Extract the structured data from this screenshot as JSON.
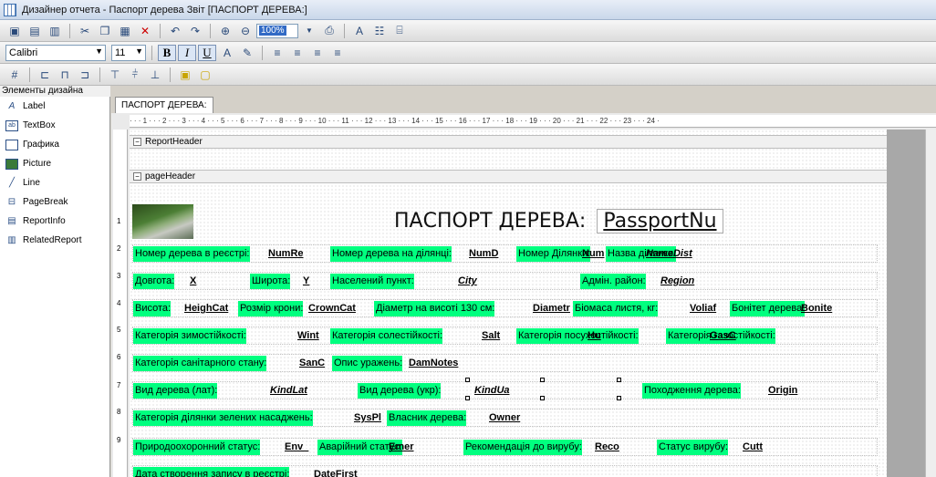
{
  "window": {
    "title": "Дизайнер отчета - Паспорт дерева Звіт [ПАСПОРТ ДЕРЕВА:]"
  },
  "toolbar": {
    "zoom": "100%",
    "font_name": "Calibri",
    "font_size": "11",
    "bold": "B",
    "italic": "I",
    "underline": "U"
  },
  "palette": {
    "title": "Элементы дизайна",
    "items": [
      {
        "label": "Label",
        "icon": "label-icon"
      },
      {
        "label": "TextBox",
        "icon": "textbox-icon"
      },
      {
        "label": "Графика",
        "icon": "graphic-icon"
      },
      {
        "label": "Picture",
        "icon": "picture-icon"
      },
      {
        "label": "Line",
        "icon": "line-icon"
      },
      {
        "label": "PageBreak",
        "icon": "pagebreak-icon"
      },
      {
        "label": "ReportInfo",
        "icon": "reportinfo-icon"
      },
      {
        "label": "RelatedReport",
        "icon": "relatedreport-icon"
      }
    ]
  },
  "tab": {
    "label": "ПАСПОРТ ДЕРЕВА:"
  },
  "ruler": {
    "top": "· · · 1 · · · 2 · · · 3 · · · 4 · · · 5 · · · 6 · · · 7 · · · 8 · · · 9 · · · 10 · · · 11 · · · 12 · · · 13 · · · 14 · · · 15 · · · 16 · · · 17 · · · 18 · · · 19 · · · 20 · · · 21 · · · 22 · · · 23 · · · 24 ·",
    "left": [
      "1",
      "2",
      "3",
      "4",
      "5",
      "6",
      "7",
      "8",
      "9"
    ]
  },
  "bands": {
    "report_header": "ReportHeader",
    "page_header": "pageHeader"
  },
  "report": {
    "title": "ПАСПОРТ ДЕРЕВА:",
    "title_field": "PassportNu",
    "rows": [
      [
        {
          "t": "lbl",
          "v": "Номер дерева в реєстрі:"
        },
        {
          "t": "fld",
          "v": "NumRe"
        },
        {
          "t": "lbl",
          "v": "Номер дерева на ділянці:"
        },
        {
          "t": "fld",
          "v": "NumD"
        },
        {
          "t": "lbl",
          "v": "Номер Ділянки:"
        },
        {
          "t": "fld",
          "v": "Num"
        },
        {
          "t": "lbl",
          "v": "Назва ділянки:"
        },
        {
          "t": "fld",
          "v": "NameDist",
          "it": true
        }
      ],
      [
        {
          "t": "lbl",
          "v": "Довгота:"
        },
        {
          "t": "fld",
          "v": "X"
        },
        {
          "t": "lbl",
          "v": "Широта:"
        },
        {
          "t": "fld",
          "v": "Y"
        },
        {
          "t": "lbl",
          "v": "Населений пункт:"
        },
        {
          "t": "fld",
          "v": "City",
          "it": true
        },
        {
          "t": "lbl",
          "v": "Адмін. район:"
        },
        {
          "t": "fld",
          "v": "Region",
          "it": true
        }
      ],
      [
        {
          "t": "lbl",
          "v": "Висота:"
        },
        {
          "t": "fld",
          "v": "HeighCat"
        },
        {
          "t": "lbl",
          "v": "Розмір крони:"
        },
        {
          "t": "fld",
          "v": "CrownCat"
        },
        {
          "t": "lbl",
          "v": "Діаметр на висоті 130 см:"
        },
        {
          "t": "fld",
          "v": "Diametr"
        },
        {
          "t": "lbl",
          "v": "Біомаса листя, кг:"
        },
        {
          "t": "fld",
          "v": "Voliaf"
        },
        {
          "t": "lbl",
          "v": "Бонітет дерева:"
        },
        {
          "t": "fld",
          "v": "Bonite"
        }
      ],
      [
        {
          "t": "lbl",
          "v": "Категорія зимостійкості:"
        },
        {
          "t": "fld",
          "v": "Wint"
        },
        {
          "t": "lbl",
          "v": "Категорія солестійкості:"
        },
        {
          "t": "fld",
          "v": "Salt"
        },
        {
          "t": "lbl",
          "v": "Категорія посухостійкості:"
        },
        {
          "t": "fld",
          "v": "Hu"
        },
        {
          "t": "lbl",
          "v": "Категорія газостійкості:"
        },
        {
          "t": "fld",
          "v": "GasC"
        }
      ],
      [
        {
          "t": "lbl",
          "v": "Категорія санітарного стану:"
        },
        {
          "t": "fld",
          "v": "SanC"
        },
        {
          "t": "lbl",
          "v": "Опис уражень:"
        },
        {
          "t": "fld",
          "v": "DamNotes"
        }
      ],
      [
        {
          "t": "lbl",
          "v": "Вид дерева (лат):"
        },
        {
          "t": "fld",
          "v": "KindLat",
          "it": true
        },
        {
          "t": "lbl",
          "v": "Вид дерева (укр):"
        },
        {
          "t": "fld",
          "v": "KindUa",
          "it": true
        },
        {
          "t": "lbl",
          "v": "Походження дерева:"
        },
        {
          "t": "fld",
          "v": "Origin"
        }
      ],
      [
        {
          "t": "lbl",
          "v": "Категорія ділянки зелених насаджень:"
        },
        {
          "t": "fld",
          "v": "SysPl"
        },
        {
          "t": "lbl",
          "v": "Власник дерева:"
        },
        {
          "t": "fld",
          "v": "Owner"
        }
      ],
      [
        {
          "t": "lbl",
          "v": "Природоохоронний статус:"
        },
        {
          "t": "fld",
          "v": "Env_"
        },
        {
          "t": "lbl",
          "v": "Аварійний статус:"
        },
        {
          "t": "fld",
          "v": "Emer"
        },
        {
          "t": "lbl",
          "v": "Рекомендація до вирубу:"
        },
        {
          "t": "fld",
          "v": "Reco"
        },
        {
          "t": "lbl",
          "v": "Статус вирубу:"
        },
        {
          "t": "fld",
          "v": "Cutt"
        }
      ],
      [
        {
          "t": "lbl",
          "v": "Дата створення запису в реєстрі:"
        },
        {
          "t": "fld",
          "v": "DateFirst"
        }
      ]
    ]
  }
}
